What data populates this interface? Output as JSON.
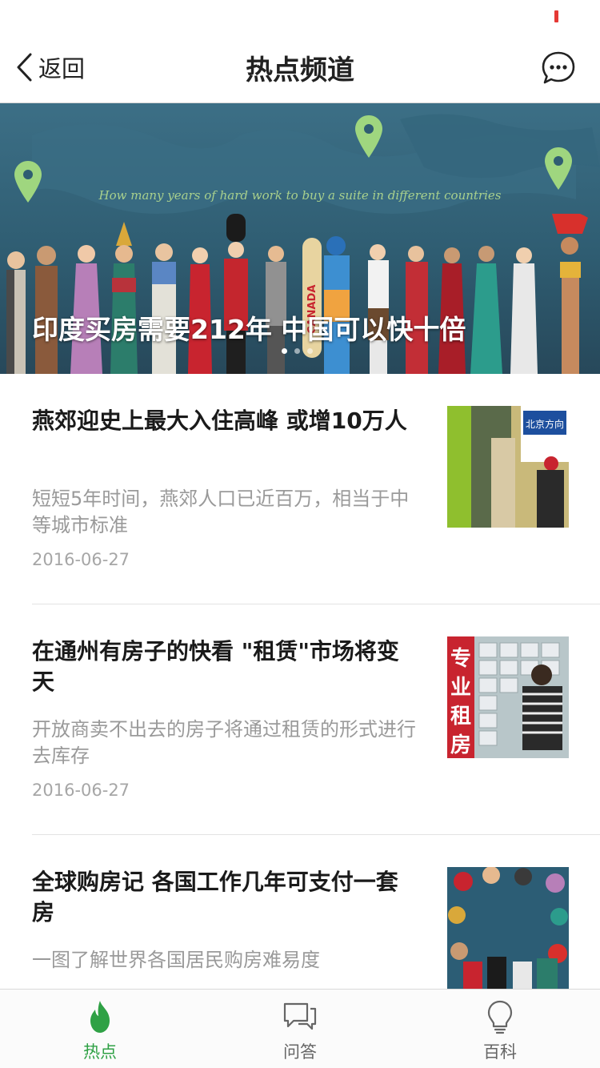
{
  "nav": {
    "back_label": "返回",
    "title": "热点频道"
  },
  "banner": {
    "subtitle": "How many years of hard work to buy a suite in different countries",
    "caption": "印度买房需要212年 中国可以快十倍",
    "board_text": "CANADA",
    "page_count": 3,
    "active_page": 1
  },
  "articles": [
    {
      "title": "燕郊迎史上最大入住高峰 或增10万人",
      "summary": "短短5年时间，燕郊人口已近百万，相当于中等城市标准",
      "date": "2016-06-27",
      "thumb_sign": "北京方向"
    },
    {
      "title": "在通州有房子的快看 \"租赁\"市场将变天",
      "summary": "开放商卖不出去的房子将通过租赁的形式进行去库存",
      "date": "2016-06-27",
      "thumb_sign": "专业租房"
    },
    {
      "title": "全球购房记 各国工作几年可支付一套房",
      "summary": "一图了解世界各国居民购房难易度",
      "date": ""
    }
  ],
  "tabs": [
    {
      "label": "热点",
      "icon": "flame-icon",
      "active": true
    },
    {
      "label": "问答",
      "icon": "chat-bubbles-icon",
      "active": false
    },
    {
      "label": "百科",
      "icon": "lightbulb-icon",
      "active": false
    }
  ],
  "colors": {
    "accent": "#2fa145",
    "banner_bg": "#2f5d72",
    "pin": "#9fd67f",
    "status_marker": "#e53935"
  }
}
